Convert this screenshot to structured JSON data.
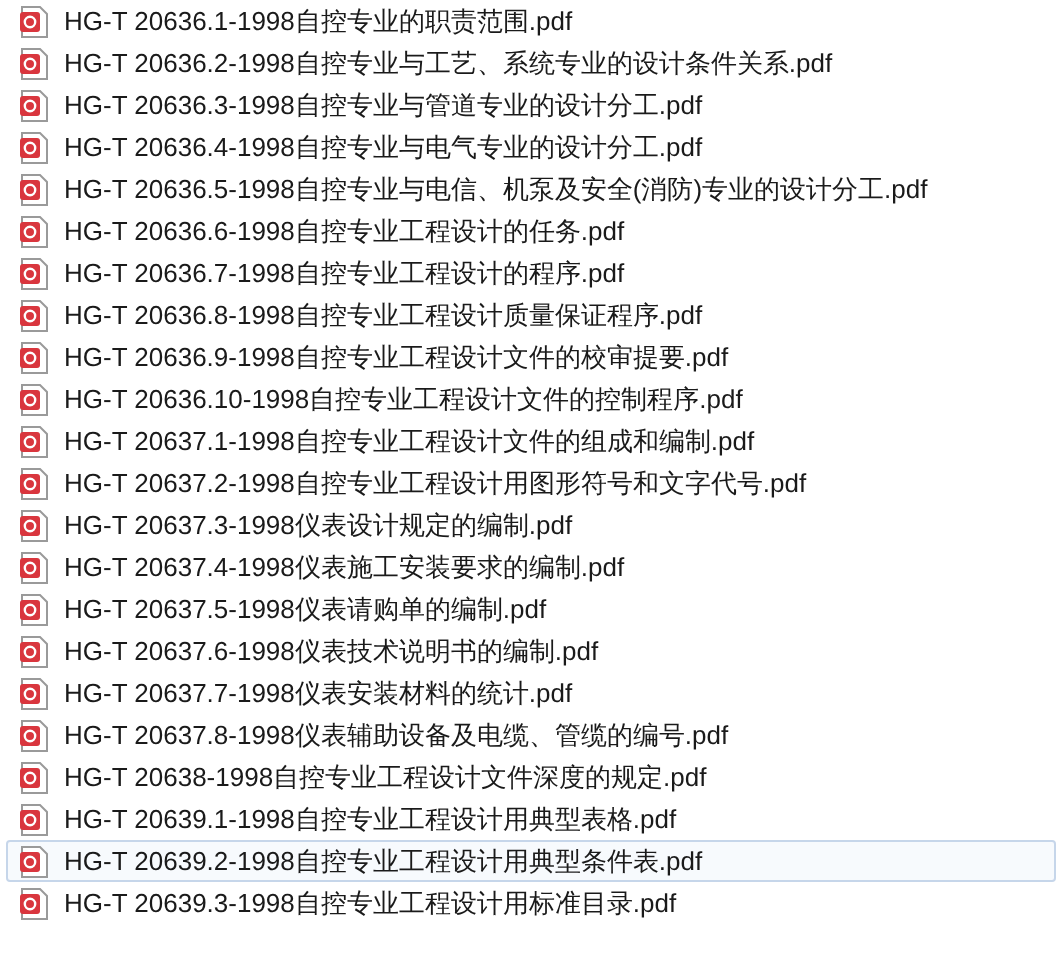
{
  "files": [
    {
      "name": "HG-T 20636.1-1998自控专业的职责范围.pdf",
      "hovered": false
    },
    {
      "name": "HG-T 20636.2-1998自控专业与工艺、系统专业的设计条件关系.pdf",
      "hovered": false
    },
    {
      "name": "HG-T 20636.3-1998自控专业与管道专业的设计分工.pdf",
      "hovered": false
    },
    {
      "name": "HG-T 20636.4-1998自控专业与电气专业的设计分工.pdf",
      "hovered": false
    },
    {
      "name": "HG-T 20636.5-1998自控专业与电信、机泵及安全(消防)专业的设计分工.pdf",
      "hovered": false
    },
    {
      "name": "HG-T 20636.6-1998自控专业工程设计的任务.pdf",
      "hovered": false
    },
    {
      "name": "HG-T 20636.7-1998自控专业工程设计的程序.pdf",
      "hovered": false
    },
    {
      "name": "HG-T 20636.8-1998自控专业工程设计质量保证程序.pdf",
      "hovered": false
    },
    {
      "name": "HG-T 20636.9-1998自控专业工程设计文件的校审提要.pdf",
      "hovered": false
    },
    {
      "name": "HG-T 20636.10-1998自控专业工程设计文件的控制程序.pdf",
      "hovered": false
    },
    {
      "name": "HG-T 20637.1-1998自控专业工程设计文件的组成和编制.pdf",
      "hovered": false
    },
    {
      "name": "HG-T 20637.2-1998自控专业工程设计用图形符号和文字代号.pdf",
      "hovered": false
    },
    {
      "name": "HG-T 20637.3-1998仪表设计规定的编制.pdf",
      "hovered": false
    },
    {
      "name": "HG-T 20637.4-1998仪表施工安装要求的编制.pdf",
      "hovered": false
    },
    {
      "name": "HG-T 20637.5-1998仪表请购单的编制.pdf",
      "hovered": false
    },
    {
      "name": "HG-T 20637.6-1998仪表技术说明书的编制.pdf",
      "hovered": false
    },
    {
      "name": "HG-T 20637.7-1998仪表安装材料的统计.pdf",
      "hovered": false
    },
    {
      "name": "HG-T 20637.8-1998仪表辅助设备及电缆、管缆的编号.pdf",
      "hovered": false
    },
    {
      "name": "HG-T 20638-1998自控专业工程设计文件深度的规定.pdf",
      "hovered": false
    },
    {
      "name": "HG-T 20639.1-1998自控专业工程设计用典型表格.pdf",
      "hovered": false
    },
    {
      "name": "HG-T 20639.2-1998自控专业工程设计用典型条件表.pdf",
      "hovered": true
    },
    {
      "name": "HG-T 20639.3-1998自控专业工程设计用标准目录.pdf",
      "hovered": false
    }
  ]
}
